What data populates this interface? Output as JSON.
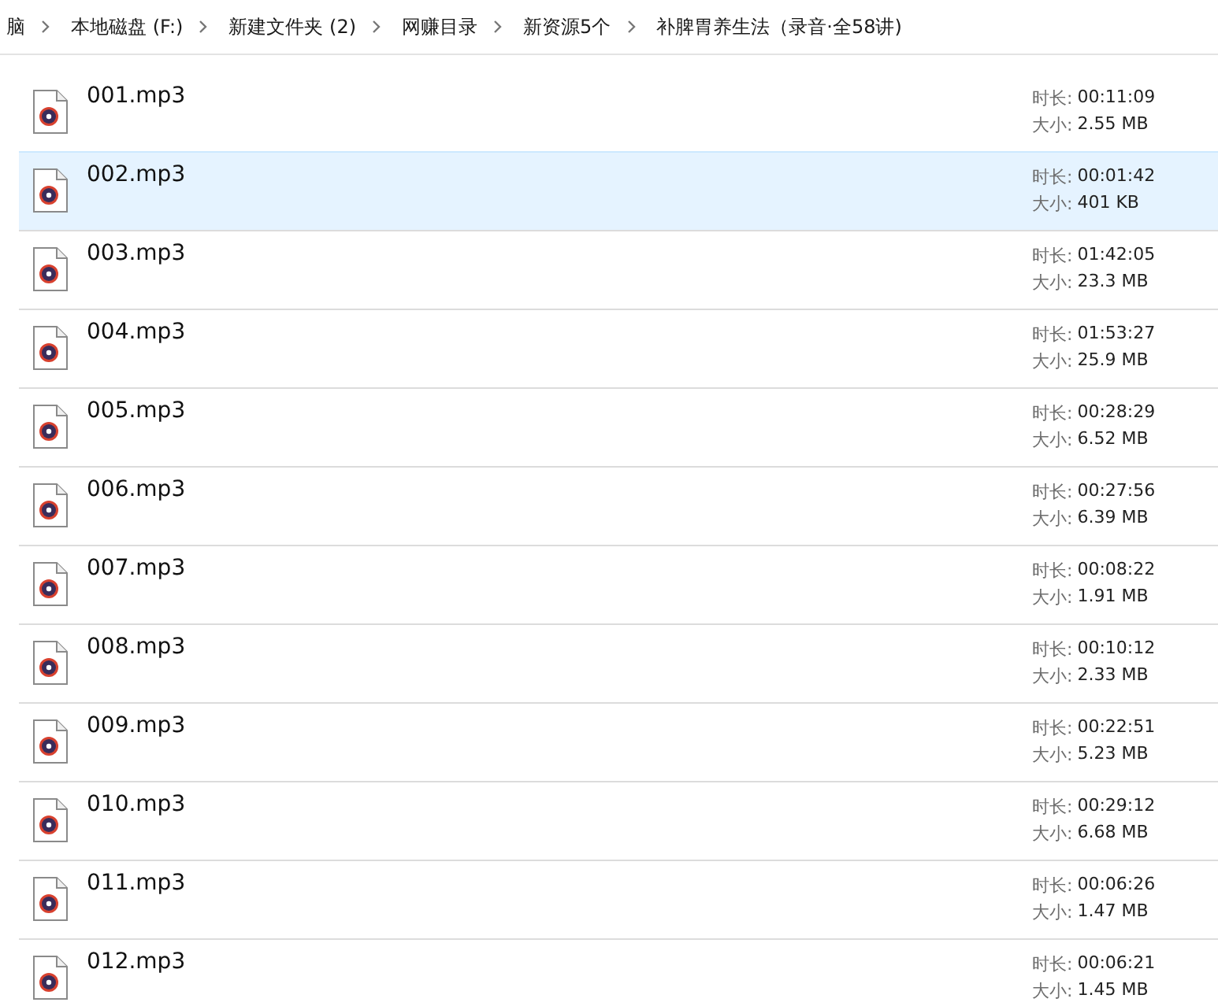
{
  "breadcrumb": [
    "脑",
    "本地磁盘 (F:)",
    "新建文件夹 (2)",
    "网赚目录",
    "新资源5个",
    "补脾胃养生法（录音·全58讲)"
  ],
  "files": [
    {
      "name": "001.mp3",
      "duration_label": "时长:",
      "duration": "00:11:09",
      "size_label": "大小:",
      "size": "2.55 MB",
      "selected": false
    },
    {
      "name": "002.mp3",
      "duration_label": "时长:",
      "duration": "00:01:42",
      "size_label": "大小:",
      "size": "401 KB",
      "selected": true
    },
    {
      "name": "003.mp3",
      "duration_label": "时长:",
      "duration": "01:42:05",
      "size_label": "大小:",
      "size": "23.3 MB",
      "selected": false
    },
    {
      "name": "004.mp3",
      "duration_label": "时长:",
      "duration": "01:53:27",
      "size_label": "大小:",
      "size": "25.9 MB",
      "selected": false
    },
    {
      "name": "005.mp3",
      "duration_label": "时长:",
      "duration": "00:28:29",
      "size_label": "大小:",
      "size": "6.52 MB",
      "selected": false
    },
    {
      "name": "006.mp3",
      "duration_label": "时长:",
      "duration": "00:27:56",
      "size_label": "大小:",
      "size": "6.39 MB",
      "selected": false
    },
    {
      "name": "007.mp3",
      "duration_label": "时长:",
      "duration": "00:08:22",
      "size_label": "大小:",
      "size": "1.91 MB",
      "selected": false
    },
    {
      "name": "008.mp3",
      "duration_label": "时长:",
      "duration": "00:10:12",
      "size_label": "大小:",
      "size": "2.33 MB",
      "selected": false
    },
    {
      "name": "009.mp3",
      "duration_label": "时长:",
      "duration": "00:22:51",
      "size_label": "大小:",
      "size": "5.23 MB",
      "selected": false
    },
    {
      "name": "010.mp3",
      "duration_label": "时长:",
      "duration": "00:29:12",
      "size_label": "大小:",
      "size": "6.68 MB",
      "selected": false
    },
    {
      "name": "011.mp3",
      "duration_label": "时长:",
      "duration": "00:06:26",
      "size_label": "大小:",
      "size": "1.47 MB",
      "selected": false
    },
    {
      "name": "012.mp3",
      "duration_label": "时长:",
      "duration": "00:06:21",
      "size_label": "大小:",
      "size": "1.45 MB",
      "selected": false
    }
  ]
}
